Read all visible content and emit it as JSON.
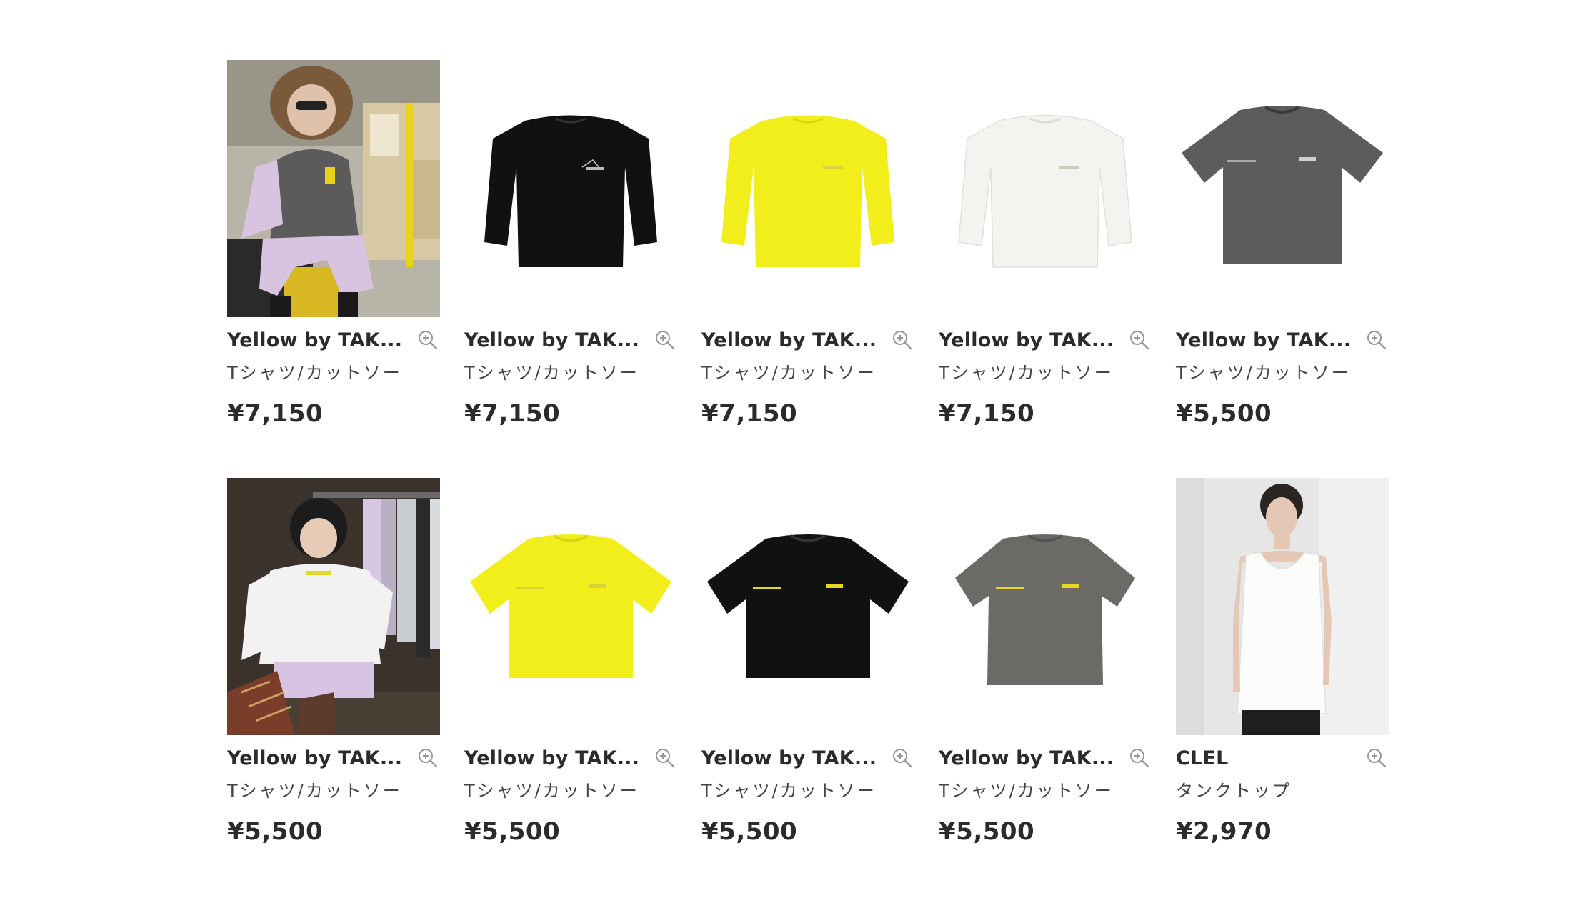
{
  "products": [
    {
      "brand": "Yellow by TAK...",
      "category": "Tシャツ/カットソー",
      "price": "¥7,150",
      "image": "model-fur-hat-purple-pants-photo",
      "color": "#5a5a5a"
    },
    {
      "brand": "Yellow by TAK...",
      "category": "Tシャツ/カットソー",
      "price": "¥7,150",
      "image": "black-long-sleeve-tee",
      "color": "#111111"
    },
    {
      "brand": "Yellow by TAK...",
      "category": "Tシャツ/カットソー",
      "price": "¥7,150",
      "image": "yellow-long-sleeve-tee",
      "color": "#f2ee1c"
    },
    {
      "brand": "Yellow by TAK...",
      "category": "Tシャツ/カットソー",
      "price": "¥7,150",
      "image": "white-long-sleeve-tee",
      "color": "#f4f3ef"
    },
    {
      "brand": "Yellow by TAK...",
      "category": "Tシャツ/カットソー",
      "price": "¥5,500",
      "image": "charcoal-short-sleeve-tee",
      "color": "#5c5c5c"
    },
    {
      "brand": "Yellow by TAK...",
      "category": "Tシャツ/カットソー",
      "price": "¥5,500",
      "image": "model-white-tee-photo",
      "color": "#eeeeee"
    },
    {
      "brand": "Yellow by TAK...",
      "category": "Tシャツ/カットソー",
      "price": "¥5,500",
      "image": "yellow-short-sleeve-tee",
      "color": "#f2ee1c"
    },
    {
      "brand": "Yellow by TAK...",
      "category": "Tシャツ/カットソー",
      "price": "¥5,500",
      "image": "black-short-sleeve-tee",
      "color": "#111111"
    },
    {
      "brand": "Yellow by TAK...",
      "category": "Tシャツ/カットソー",
      "price": "¥5,500",
      "image": "gray-short-sleeve-tee",
      "color": "#6b6a66"
    },
    {
      "brand": "CLEL",
      "category": "タンクトップ",
      "price": "¥2,970",
      "image": "model-white-tank-top-photo",
      "color": "#f2f2f0"
    }
  ],
  "icons": {
    "zoom": "zoom-in-icon"
  }
}
